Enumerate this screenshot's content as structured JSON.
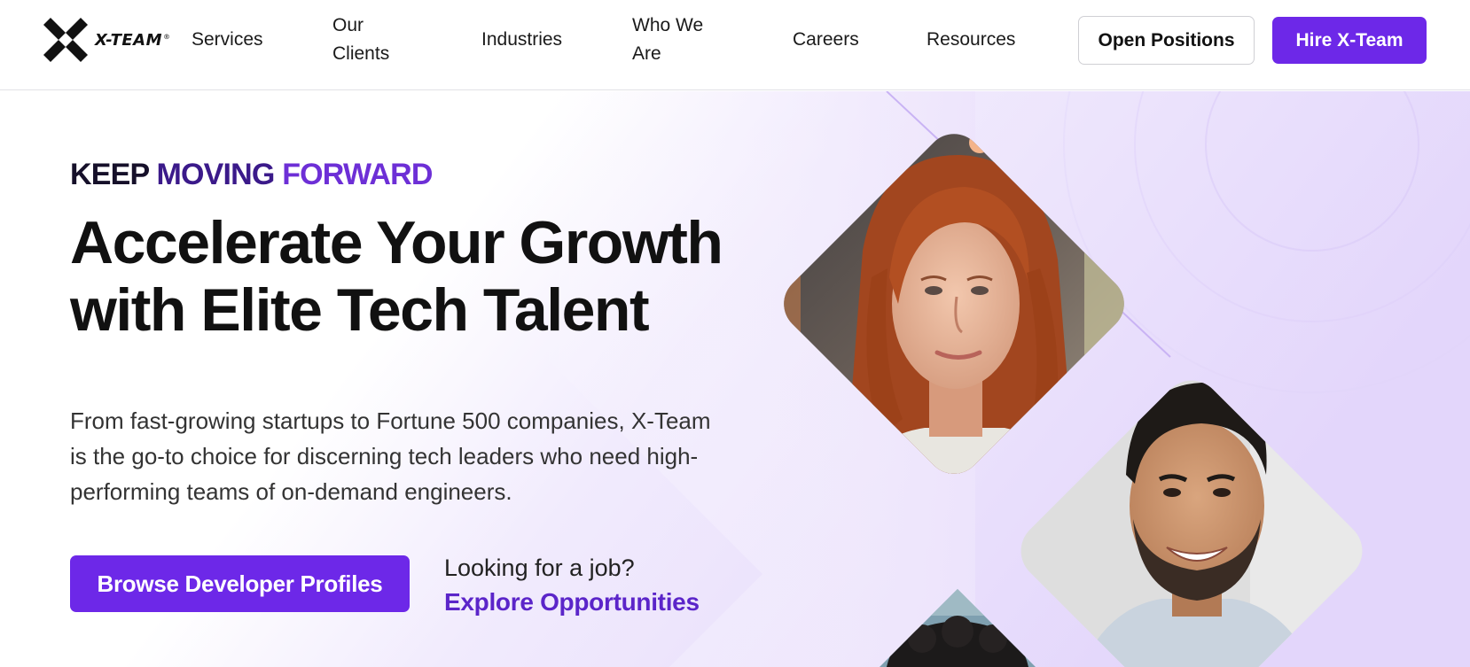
{
  "brand": {
    "name": "X-TEAM",
    "registered": "®",
    "accent_color": "#6d28e8"
  },
  "nav": {
    "items": [
      {
        "label": "Services"
      },
      {
        "label": "Our Clients"
      },
      {
        "label": "Industries"
      },
      {
        "label": "Who We Are"
      },
      {
        "label": "Careers"
      },
      {
        "label": "Resources"
      }
    ],
    "open_positions_label": "Open Positions",
    "hire_label": "Hire X-Team"
  },
  "hero": {
    "eyebrow": {
      "word1": "KEEP",
      "word2": "MOVING",
      "word3": "FORWARD"
    },
    "headline": "Accelerate Your Growth with Elite Tech Talent",
    "lead": "From fast-growing startups to Fortune 500 companies, X-Team is the go-to choice for discerning tech leaders who need high-performing teams of on-demand engineers.",
    "cta_label": "Browse Developer Profiles",
    "job_question": "Looking for a job?",
    "job_link": "Explore Opportunities"
  }
}
